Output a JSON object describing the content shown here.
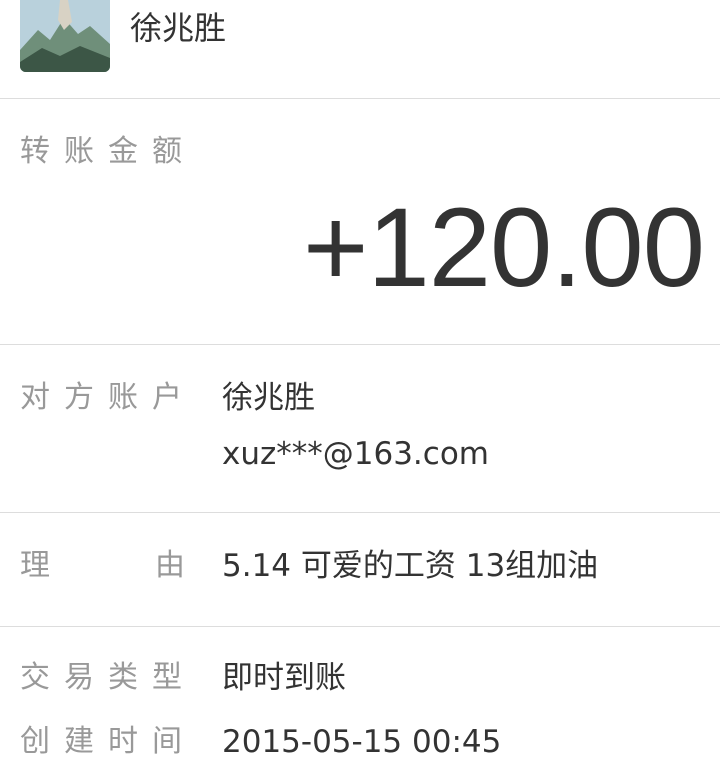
{
  "header": {
    "name": "徐兆胜"
  },
  "amount_section": {
    "label": "转账金额",
    "amount": "+120.00"
  },
  "account_section": {
    "label": "对方账户",
    "name": "徐兆胜",
    "email": "xuz***@163.com"
  },
  "reason_section": {
    "label_left": "理",
    "label_right": "由",
    "value": "5.14 可爱的工资 13组加油"
  },
  "detail_section": {
    "type_label": "交易类型",
    "type_value": "即时到账",
    "time_label": "创建时间",
    "time_value": "2015-05-15 00:45"
  }
}
